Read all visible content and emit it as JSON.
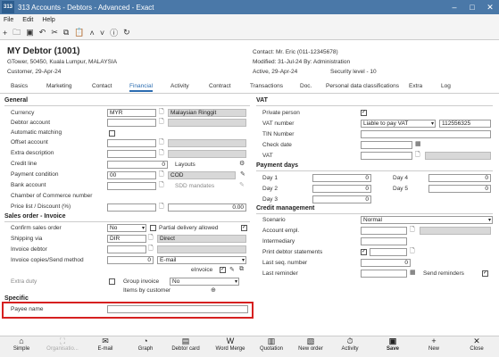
{
  "window": {
    "title": "313 Accounts - Debtors - Advanced - Exact",
    "logo": "313",
    "minimize": "–",
    "restore": "□",
    "close": "✕"
  },
  "menu": {
    "file": "File",
    "edit": "Edit",
    "help": "Help"
  },
  "toolbar": {
    "icons": [
      "add-icon",
      "open-icon",
      "save-icon",
      "undo-icon",
      "scissors-icon",
      "copy-icon",
      "paste-icon",
      "up-icon",
      "down-icon",
      "info-icon",
      "refresh-icon"
    ]
  },
  "header": {
    "title": "MY Debtor (1001)",
    "address": "GTower, 50450, Kuala Lumpur, MALAYSIA",
    "customer": "Customer, 29-Apr-24",
    "contact": "Contact: Mr. Eric (011-12345678)",
    "modified": "Modified: 31-Jul-24  By: Administration",
    "active": "Active, 29-Apr-24",
    "security": "Security level - 10"
  },
  "tabs": [
    "Basics",
    "Marketing",
    "Contact",
    "Financial",
    "Activity",
    "Contract",
    "Transactions",
    "Doc.",
    "Personal data classifications",
    "Extra",
    "Log"
  ],
  "general": {
    "section": "General",
    "currency_label": "Currency",
    "currency_code": "MYR",
    "currency_name": "Malaysian Ringgit",
    "debtor_account_label": "Debtor account",
    "auto_matching_label": "Automatic matching",
    "offset_account_label": "Offset account",
    "extra_description_label": "Extra description",
    "credit_line_label": "Credit line",
    "credit_line_value": "0",
    "layouts_label": "Layouts",
    "payment_condition_label": "Payment condition",
    "payment_condition_code": "00",
    "payment_condition_name": "COD",
    "bank_account_label": "Bank account",
    "sdd_mandates_label": "SDD mandates",
    "chamber_label": "Chamber of Commerce number",
    "price_list_label": "Price list / Discount (%)",
    "discount_value": "0.00"
  },
  "sales": {
    "section": "Sales order - Invoice",
    "confirm_label": "Confirm sales order",
    "confirm_value": "No",
    "partial_label": "Partial delivery allowed",
    "shipping_label": "Shipping via",
    "shipping_code": "DIR",
    "shipping_name": "Direct",
    "invoice_debtor_label": "Invoice debtor",
    "invoice_copies_label": "Invoice copies/Send method",
    "invoice_copies_value": "0",
    "send_method_value": "E-mail",
    "einvoice_label": "eInvoice",
    "extra_duty_label": "Extra duty",
    "group_invoice_label": "Group invoice",
    "group_invoice_value": "No",
    "items_by_customer_label": "Items by customer"
  },
  "specific": {
    "section": "Specific",
    "payee_label": "Payee name",
    "payee_value": ""
  },
  "vat": {
    "section": "VAT",
    "private_person_label": "Private person",
    "vat_number_label": "VAT number",
    "vat_number_value": "Liable to pay VAT",
    "vat_number_code": "112556325",
    "tin_label": "TIN Number",
    "check_date_label": "Check date",
    "vat_label": "VAT"
  },
  "payment_days": {
    "section": "Payment days",
    "day1_label": "Day 1",
    "day1_value": "0",
    "day2_label": "Day 2",
    "day2_value": "0",
    "day3_label": "Day 3",
    "day3_value": "0",
    "day4_label": "Day 4",
    "day4_value": "0",
    "day5_label": "Day 5",
    "day5_value": "0"
  },
  "credit_mgmt": {
    "section": "Credit management",
    "scenario_label": "Scenario",
    "scenario_value": "Normal",
    "account_empl_label": "Account empl.",
    "intermediary_label": "Intermediary",
    "print_statements_label": "Print debtor statements",
    "last_seq_label": "Last seq. number",
    "last_seq_value": "0",
    "last_reminder_label": "Last reminder",
    "send_reminders_label": "Send reminders"
  },
  "bottom": {
    "simple": "Simple",
    "organisation": "Organisatio...",
    "email": "E-mail",
    "graph": "Graph",
    "debtor_card": "Debtor card",
    "word_merge": "Word Merge",
    "quotation": "Quotation",
    "new_order": "New order",
    "activity": "Activity",
    "save": "Save",
    "new": "New",
    "close": "Close"
  },
  "colors": {
    "titlebar": "#4a78a8",
    "accent": "#2b6cb0",
    "highlight_box": "#d62020"
  }
}
